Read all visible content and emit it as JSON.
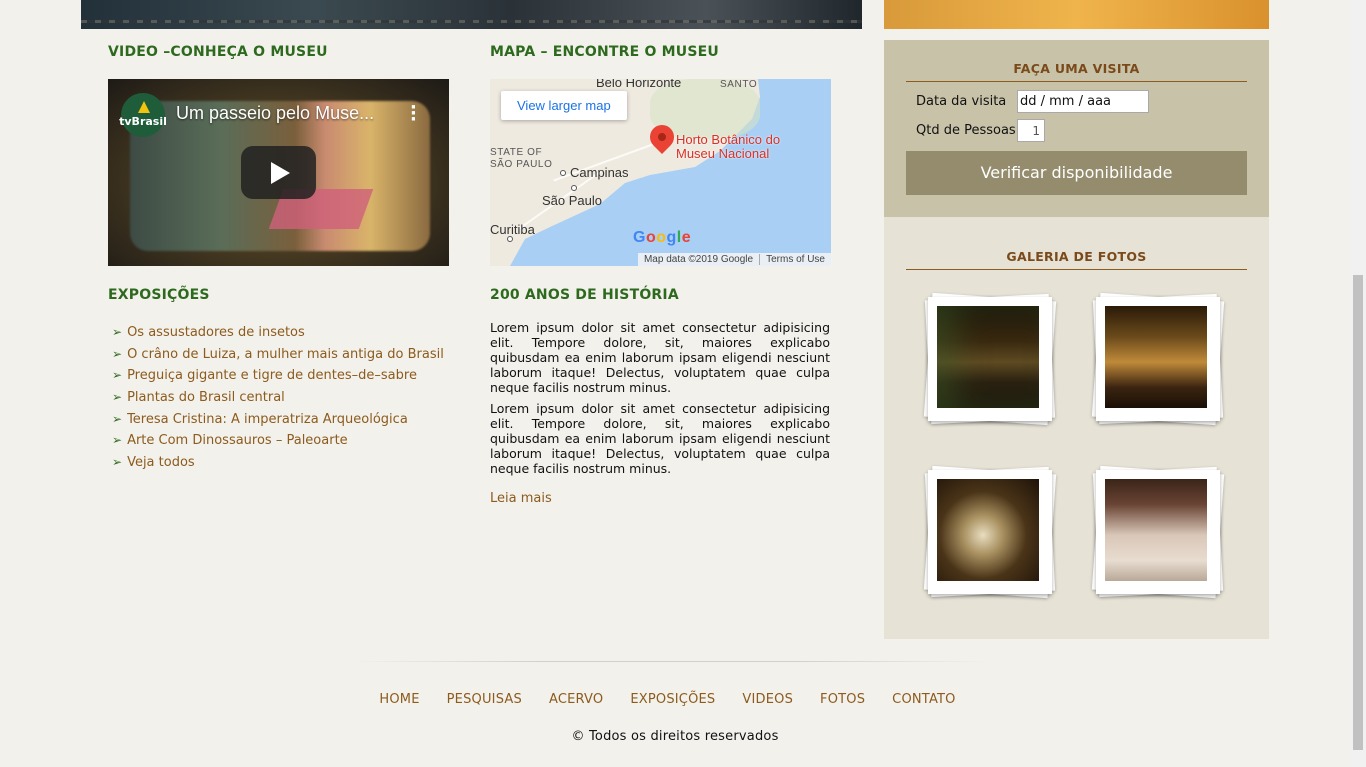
{
  "sections": {
    "video_title": "VIDEO –CONHEÇA O MUSEU",
    "map_title": "MAPA – ENCONTRE O MUSEU",
    "exhibitions_title": "EXPOSIÇÕES",
    "history_title": "200 ANOS DE HISTÓRIA"
  },
  "video": {
    "title": "Um passeio pelo Muse...",
    "channel_logo": "tvBrasil"
  },
  "map": {
    "view_larger": "View larger map",
    "place_name_line1": "Horto Botânico do",
    "place_name_line2": "Museu Nacional",
    "labels": {
      "belo_horizonte": "Belo Horizonte",
      "santo": "SANTO",
      "state_of": "STATE OF",
      "sao_paulo_state": "SÃO PAULO",
      "campinas": "Campinas",
      "sao_paulo": "São Paulo",
      "curitiba": "Curitiba"
    },
    "google": "Google",
    "map_data": "Map data ©2019 Google",
    "terms": "Terms of Use"
  },
  "exhibitions": [
    "Os assustadores de insetos",
    "O crâno de Luiza, a mulher mais antiga do Brasil",
    "Preguiça gigante e tigre de dentes–de–sabre",
    "Plantas do Brasil central",
    "Teresa Cristina: A imperatriza Arqueológica",
    "Arte Com Dinossauros – Paleoarte",
    "Veja todos"
  ],
  "history": {
    "paragraph1": "Lorem ipsum dolor sit amet consectetur adipisicing elit. Tempore dolore, sit, maiores explicabo quibusdam ea enim laborum ipsam eligendi nesciunt laborum itaque! Delectus, voluptatem quae culpa neque facilis nostrum minus.",
    "paragraph2": "Lorem ipsum dolor sit amet consectetur adipisicing elit. Tempore dolore, sit, maiores explicabo quibusdam ea enim laborum ipsam eligendi nesciunt laborum itaque! Delectus, voluptatem quae culpa neque facilis nostrum minus.",
    "read_more": "Leia mais"
  },
  "visit": {
    "title": "FAÇA UMA VISITA",
    "date_label": "Data da visita",
    "date_placeholder": "dd / mm / aaa",
    "qty_label": "Qtd de Pessoas",
    "qty_value": "1",
    "button": "Verificar disponibilidade"
  },
  "gallery": {
    "title": "GALERIA DE FOTOS"
  },
  "footer": {
    "nav": [
      "HOME",
      "PESQUISAS",
      "ACERVO",
      "EXPOSIÇÕES",
      "VIDEOS",
      "FOTOS",
      "CONTATO"
    ],
    "copyright": "© Todos os direitos reservados"
  },
  "colors": {
    "heading_green": "#2d6a1e",
    "link_brown": "#8c5b1d",
    "sidebar_visit_bg": "#c8c3a8",
    "sidebar_gallery_bg": "#e6e2d6",
    "button_bg": "#948c6c"
  }
}
